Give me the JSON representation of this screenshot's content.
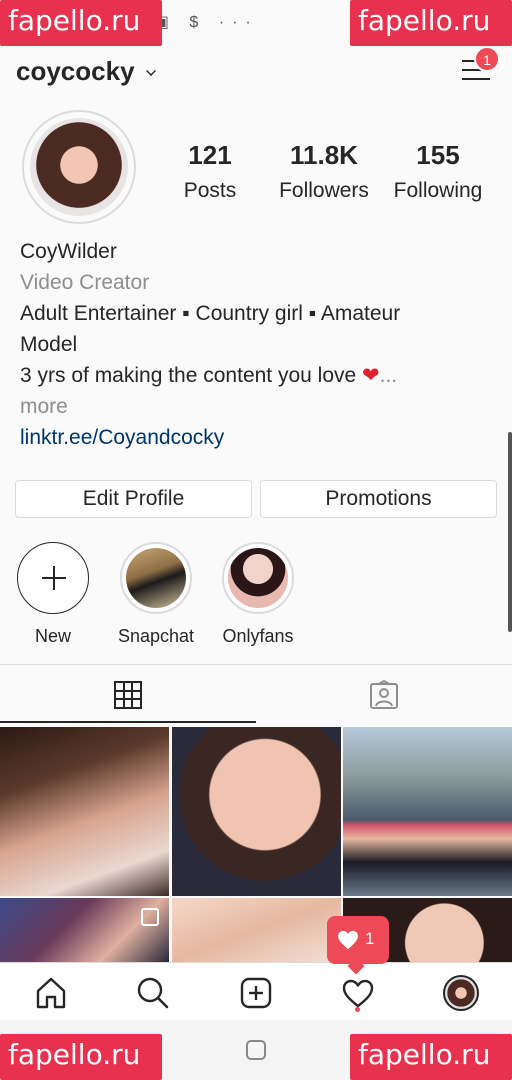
{
  "watermark": {
    "text": "fapello.ru"
  },
  "status_bar": {
    "icons": "✉ ▣ $ ···"
  },
  "header": {
    "username": "coycocky",
    "menu_badge": "1"
  },
  "stats": [
    {
      "value": "121",
      "label": "Posts"
    },
    {
      "value": "11.8K",
      "label": "Followers"
    },
    {
      "value": "155",
      "label": "Following"
    }
  ],
  "bio": {
    "name": "CoyWilder",
    "category": "Video Creator",
    "line1": "Adult Entertainer ▪ Country girl ▪ Amateur",
    "line2": "Model",
    "line3_text": "3 yrs of making the content you love ",
    "line3_emoji": "❤",
    "line3_ellipsis": "...",
    "more": "more",
    "link": "linktr.ee/Coyandcocky"
  },
  "buttons": {
    "edit_profile": "Edit Profile",
    "promotions": "Promotions"
  },
  "highlights": [
    {
      "label": "New"
    },
    {
      "label": "Snapchat"
    },
    {
      "label": "Onlyfans"
    }
  ],
  "notification": {
    "count": "1"
  },
  "icons": {
    "grid": "grid-icon",
    "tagged": "tagged-icon",
    "home": "home-icon",
    "search": "search-icon",
    "new_post": "plus-square-icon",
    "activity": "heart-icon",
    "profile": "profile-avatar-icon"
  },
  "colors": {
    "accent_red": "#ed4956",
    "link_blue": "#003569",
    "muted_gray": "#8e8e8e",
    "watermark_red": "#e8314f"
  }
}
